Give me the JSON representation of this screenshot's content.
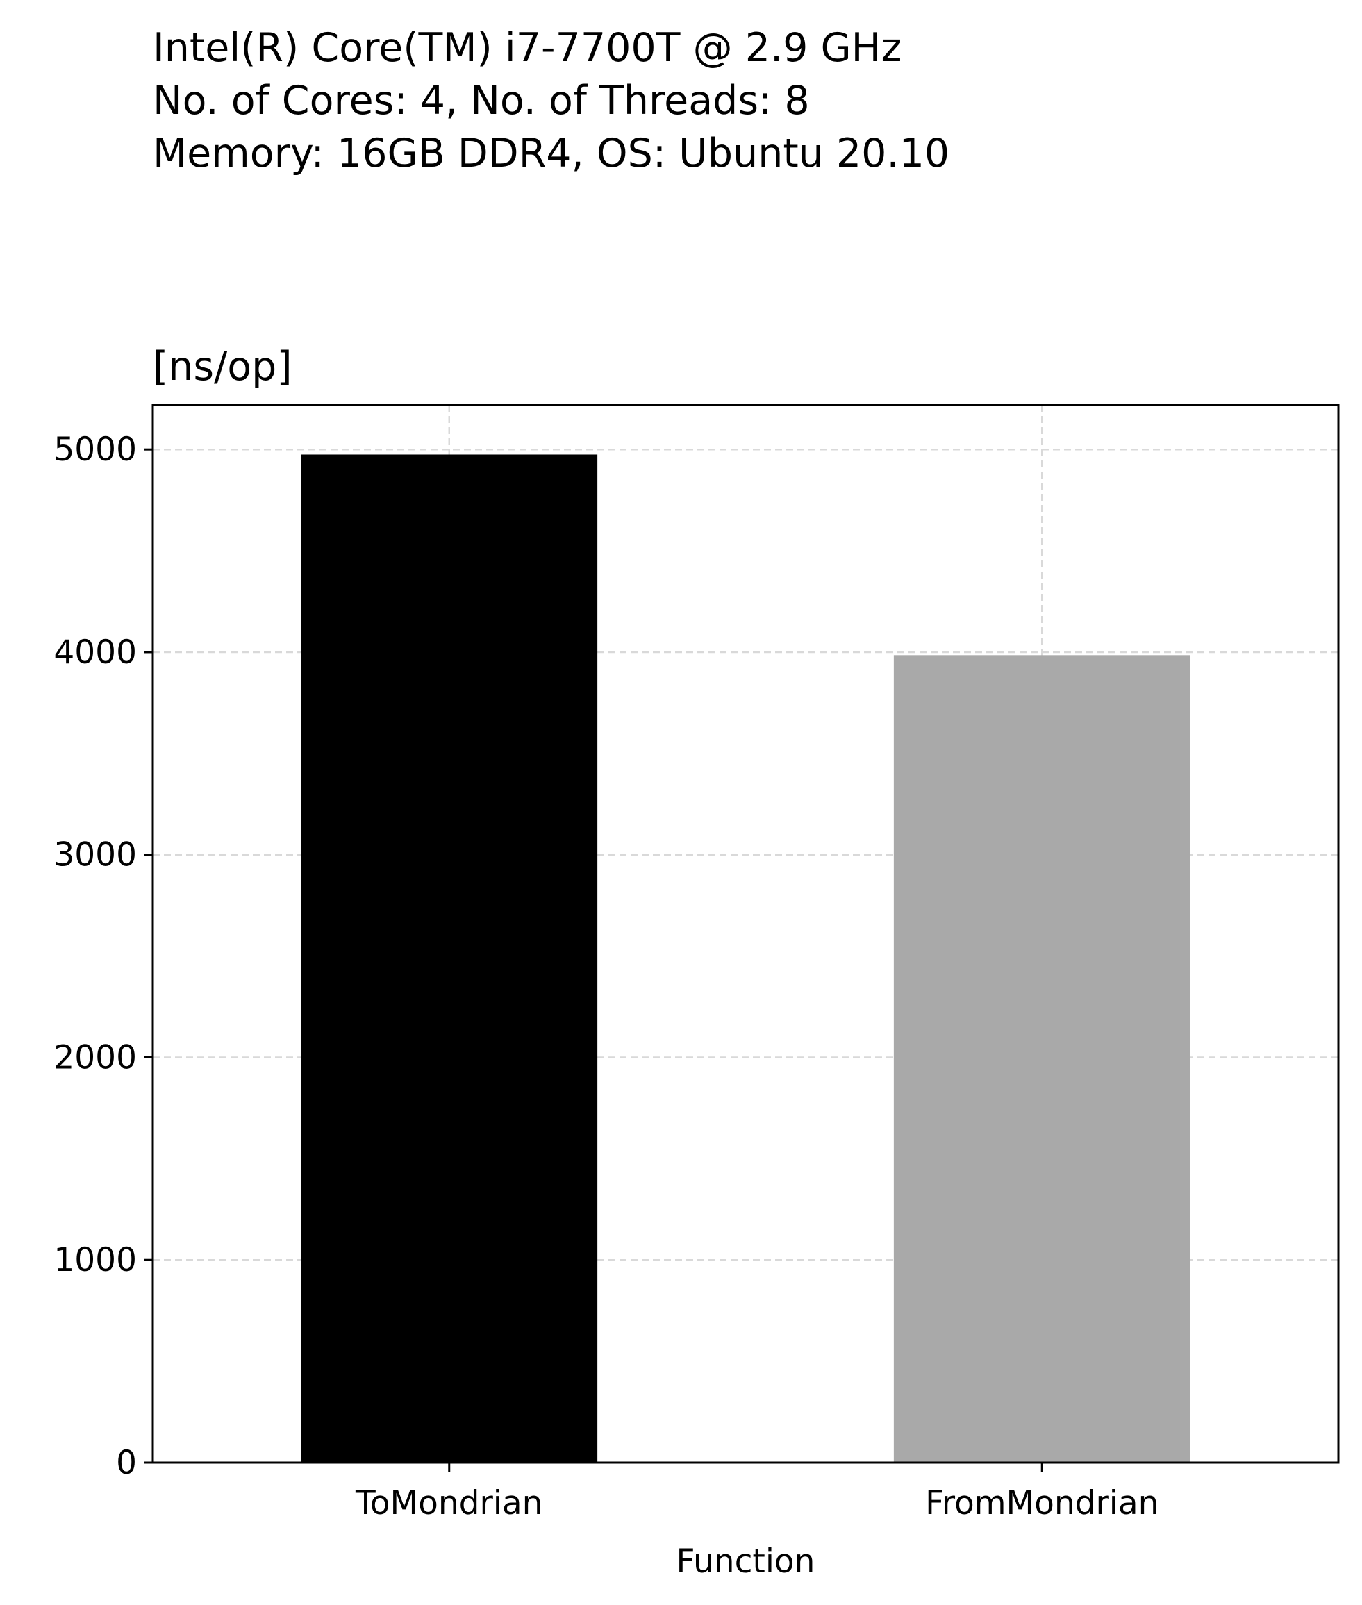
{
  "chart_data": {
    "type": "bar",
    "title_lines": [
      "Intel(R) Core(TM) i7-7700T @ 2.9 GHz",
      "No. of Cores: 4, No. of Threads: 8",
      "Memory: 16GB DDR4, OS: Ubuntu 20.10"
    ],
    "ylabel": "[ns/op]",
    "xlabel": "Function",
    "categories": [
      "ToMondrian",
      "FromMondrian"
    ],
    "values": [
      4975,
      3985
    ],
    "colors": [
      "#000000",
      "#a9a9a9"
    ],
    "ylim": [
      0,
      5220
    ],
    "yticks": [
      0,
      1000,
      2000,
      3000,
      4000,
      5000
    ],
    "grid": true
  }
}
